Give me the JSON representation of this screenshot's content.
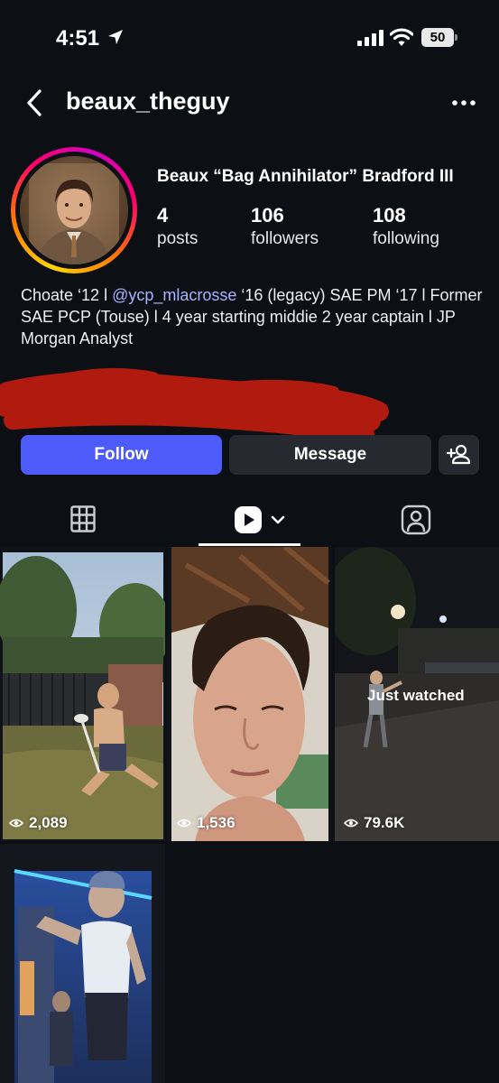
{
  "status_bar": {
    "time": "4:51",
    "battery": "50",
    "location_icon": "location-arrow-icon",
    "signal_icon": "cellular-signal-icon",
    "wifi_icon": "wifi-icon"
  },
  "nav": {
    "username": "beaux_theguy",
    "back_icon": "chevron-left-icon",
    "more_icon": "more-horizontal-icon"
  },
  "profile": {
    "full_name": "Beaux “Bag Annihilator” Bradford III",
    "stats": [
      {
        "value": "4",
        "label": "posts"
      },
      {
        "value": "106",
        "label": "followers"
      },
      {
        "value": "108",
        "label": "following"
      }
    ],
    "bio": {
      "part1": "Choate ‘12 l ",
      "mention": "@ycp_mlacrosse",
      "part2": " ‘16 (legacy) SAE PM ‘17 l Former SAE PCP (Touse) l 4 year starting middie 2 year captain l JP Morgan Analyst"
    }
  },
  "actions": {
    "follow": "Follow",
    "message": "Message",
    "add_user_icon": "add-user-icon"
  },
  "tabs": {
    "grid_icon": "grid-icon",
    "reels_icon": "reels-icon",
    "tagged_icon": "tagged-icon",
    "active": "reels"
  },
  "reels": [
    {
      "views": "2,089"
    },
    {
      "views": "1,536"
    },
    {
      "views": "79.6K",
      "badge": "Just watched"
    },
    {
      "views": ""
    }
  ],
  "colors": {
    "background": "#0c0f14",
    "follow_button": "#4c5bfa",
    "secondary_button": "#26292f",
    "mention": "#a9b2ff",
    "redaction": "#b01a0f"
  }
}
